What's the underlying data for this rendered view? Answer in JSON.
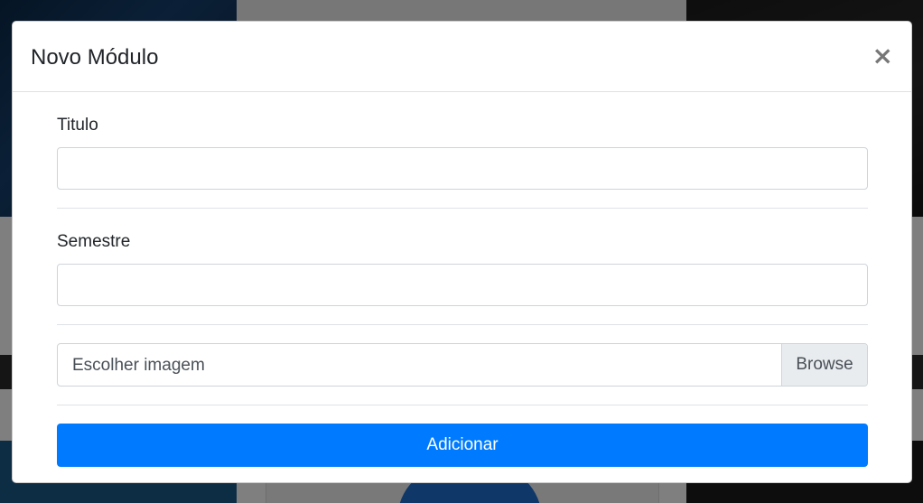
{
  "modal": {
    "title": "Novo Módulo",
    "close_label": "×",
    "fields": {
      "titulo": {
        "label": "Titulo",
        "value": "",
        "placeholder": ""
      },
      "semestre": {
        "label": "Semestre",
        "value": "",
        "placeholder": ""
      }
    },
    "file": {
      "label": "Escolher imagem",
      "browse_label": "Browse"
    },
    "submit_label": "Adicionar"
  },
  "colors": {
    "primary": "#007bff",
    "backdrop": "rgba(0,0,0,0.5)"
  }
}
